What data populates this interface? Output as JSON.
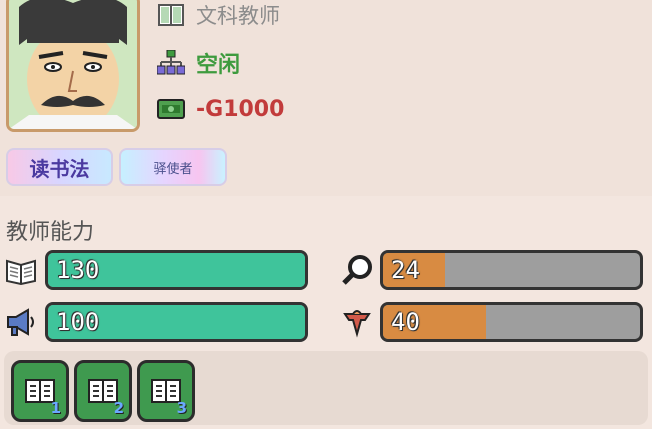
{
  "teacher": {
    "role": "文科教师",
    "status": "空闲",
    "salary": "-G1000"
  },
  "traits": [
    "读书法",
    "驿使者"
  ],
  "abilities": {
    "title": "教师能力",
    "stats": [
      {
        "icon": "book-icon",
        "value": 130,
        "max": 130,
        "color": "#3fc49b"
      },
      {
        "icon": "magnifier-icon",
        "value": 24,
        "max": 100,
        "color": "#d88b42"
      },
      {
        "icon": "megaphone-icon",
        "value": 100,
        "max": 100,
        "color": "#3fc49b"
      },
      {
        "icon": "flame-icon",
        "value": 40,
        "max": 100,
        "color": "#d88b42"
      }
    ]
  },
  "books": [
    {
      "icon": "book-icon",
      "level": "1"
    },
    {
      "icon": "book-icon",
      "level": "2"
    },
    {
      "icon": "book-icon",
      "level": "3"
    }
  ]
}
